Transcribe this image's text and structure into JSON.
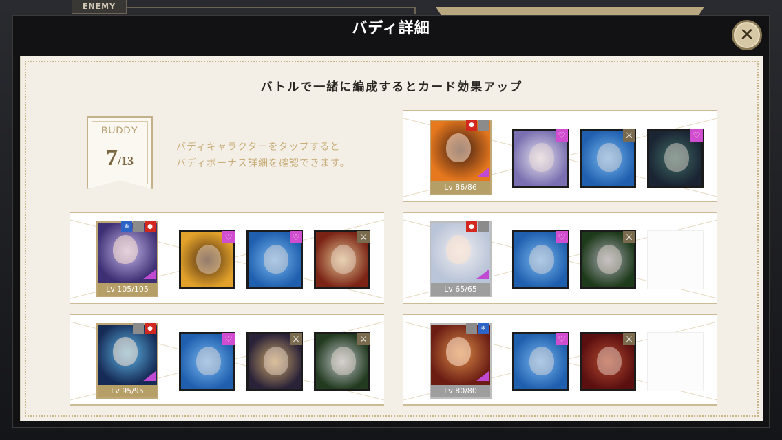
{
  "background": {
    "enemy_label": "ENEMY"
  },
  "modal": {
    "title": "バディ詳細",
    "close_symbol": "✕",
    "subtitle": "バトルで一緒に編成するとカード効果アップ",
    "badge": {
      "title": "BUDDY",
      "count": "7",
      "total": "/13"
    },
    "hint_line1": "バディキャラクターをタップすると",
    "hint_line2": "バディボーナス詳細を確認できます。"
  },
  "groups": [
    {
      "level": "Lv 86/86",
      "frame": "gold",
      "attrs": [
        "red",
        "grey"
      ],
      "attr_icons": [
        "fire-icon",
        "blank-icon"
      ],
      "main_colors": [
        "#e6781e",
        "#3b1c12"
      ],
      "buddies": [
        {
          "relation": "heart-icon",
          "colors": [
            "#7a6fb0",
            "#e9e6f0"
          ]
        },
        {
          "relation": "sword-icon",
          "colors": [
            "#1f5fae",
            "#79b8f0"
          ]
        },
        {
          "relation": "heart-icon",
          "colors": [
            "#1a2433",
            "#3f6b63"
          ]
        }
      ]
    },
    {
      "level": "Lv 105/105",
      "frame": "gold",
      "attrs": [
        "blue",
        "grey",
        "red"
      ],
      "attr_icons": [
        "water-icon",
        "blank-icon",
        "fire-icon"
      ],
      "main_colors": [
        "#3d2f73",
        "#c7b8ea"
      ],
      "buddies": [
        {
          "relation": "heart-icon",
          "colors": [
            "#e1a12a",
            "#4a2a14"
          ]
        },
        {
          "relation": "heart-icon",
          "colors": [
            "#1f5fae",
            "#79b8f0"
          ]
        },
        {
          "relation": "sword-icon",
          "colors": [
            "#7b2315",
            "#e2c491"
          ]
        }
      ]
    },
    {
      "level": "Lv 65/65",
      "frame": "silver",
      "attrs": [
        "red",
        "grey"
      ],
      "attr_icons": [
        "fire-icon",
        "blank-icon"
      ],
      "main_colors": [
        "#b9c4d8",
        "#f0eef0"
      ],
      "buddies": [
        {
          "relation": "heart-icon",
          "colors": [
            "#1f5fae",
            "#79b8f0"
          ]
        },
        {
          "relation": "sword-icon",
          "colors": [
            "#1d3a1a",
            "#a8a8b0"
          ]
        },
        null
      ]
    },
    {
      "level": "Lv 95/95",
      "frame": "gold",
      "attrs": [
        "grey",
        "red"
      ],
      "attr_icons": [
        "blank-icon",
        "fire-icon"
      ],
      "main_colors": [
        "#152a55",
        "#5fb6e6"
      ],
      "buddies": [
        {
          "relation": "heart-icon",
          "colors": [
            "#1f5fae",
            "#79b8f0"
          ]
        },
        {
          "relation": "sword-icon",
          "colors": [
            "#2a2238",
            "#caa56a"
          ]
        },
        {
          "relation": "sword-icon",
          "colors": [
            "#223a1f",
            "#bfc4c8"
          ]
        }
      ]
    },
    {
      "level": "Lv 80/80",
      "frame": "silver",
      "attrs": [
        "grey",
        "blue"
      ],
      "attr_icons": [
        "blank-icon",
        "water-icon"
      ],
      "main_colors": [
        "#6b1d14",
        "#d98a46"
      ],
      "buddies": [
        {
          "relation": "heart-icon",
          "colors": [
            "#1f5fae",
            "#79b8f0"
          ]
        },
        {
          "relation": "sword-icon",
          "colors": [
            "#5a0f10",
            "#b34a2e"
          ]
        },
        null
      ]
    }
  ]
}
